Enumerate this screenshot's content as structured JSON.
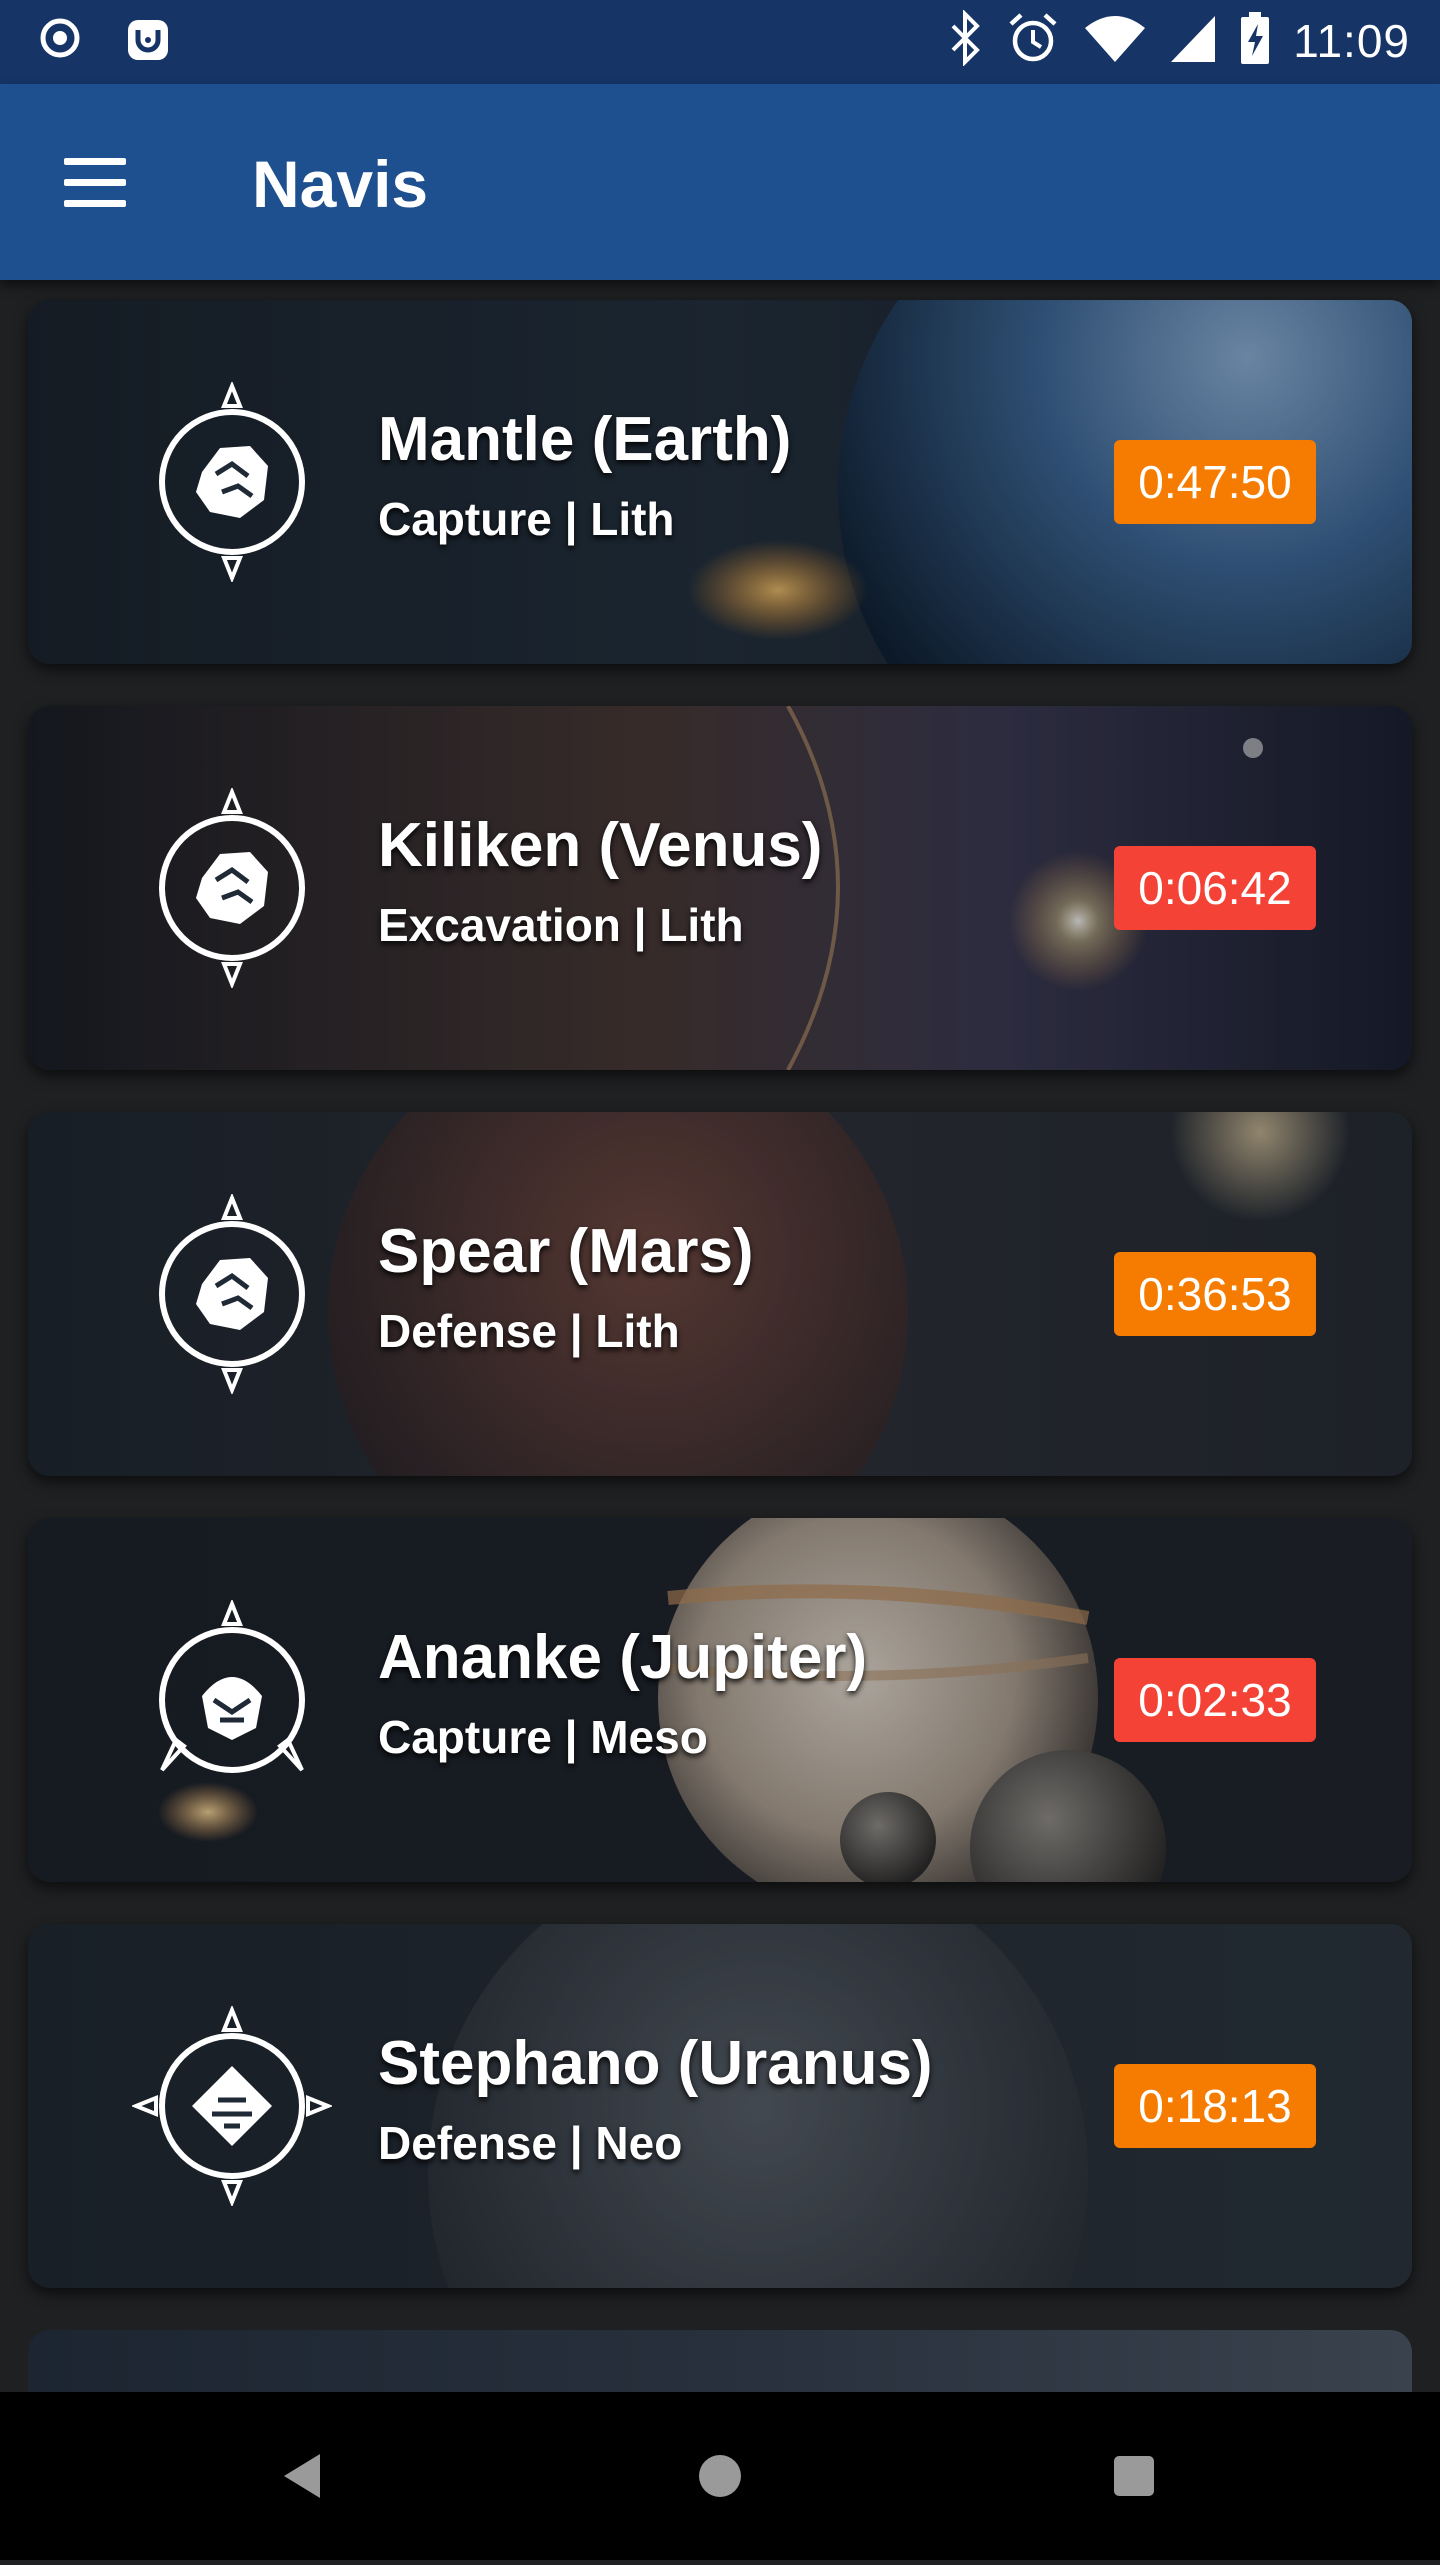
{
  "status_bar": {
    "time": "11:09",
    "left_icons": [
      "record-icon",
      "notification-app-icon"
    ],
    "right_icons": [
      "bluetooth-icon",
      "alarm-icon",
      "wifi-icon",
      "signal-icon",
      "battery-charging-icon"
    ]
  },
  "app_bar": {
    "title": "Navis",
    "menu_icon": "hamburger-menu-icon"
  },
  "missions": [
    {
      "title": "Mantle (Earth)",
      "subtitle": "Capture | Lith",
      "timer": "0:47:50",
      "timer_color": "#f57c00",
      "relic_icon": "lith-relic-icon"
    },
    {
      "title": "Kiliken (Venus)",
      "subtitle": "Excavation | Lith",
      "timer": "0:06:42",
      "timer_color": "#f44336",
      "relic_icon": "lith-relic-icon"
    },
    {
      "title": "Spear (Mars)",
      "subtitle": "Defense | Lith",
      "timer": "0:36:53",
      "timer_color": "#f57c00",
      "relic_icon": "lith-relic-icon"
    },
    {
      "title": "Ananke (Jupiter)",
      "subtitle": "Capture | Meso",
      "timer": "0:02:33",
      "timer_color": "#f44336",
      "relic_icon": "meso-relic-icon"
    },
    {
      "title": "Stephano (Uranus)",
      "subtitle": "Defense | Neo",
      "timer": "0:18:13",
      "timer_color": "#f57c00",
      "relic_icon": "neo-relic-icon"
    }
  ],
  "nav_bar": {
    "buttons": [
      "back-icon",
      "home-icon",
      "recents-icon"
    ]
  }
}
